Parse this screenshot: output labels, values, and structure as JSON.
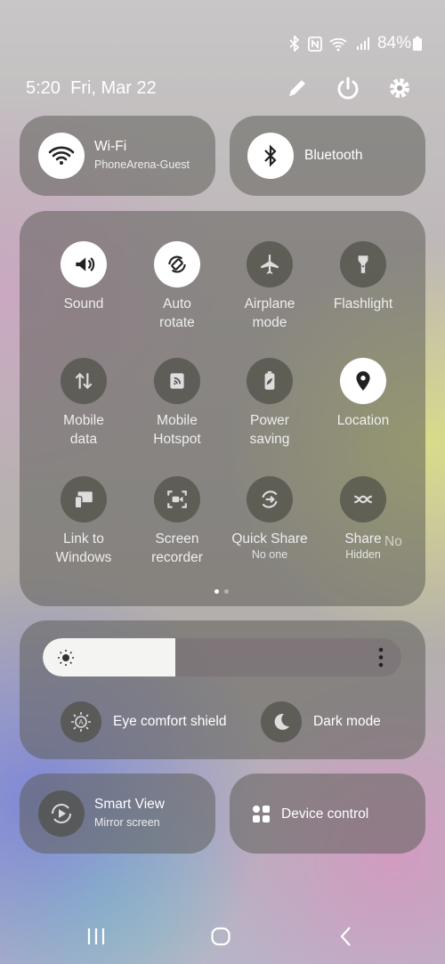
{
  "status_bar": {
    "icons": [
      "bluetooth-icon",
      "nfc-icon",
      "wifi-icon",
      "signal-icon"
    ],
    "battery": "84%",
    "battery_level": 0.84
  },
  "header": {
    "time": "5:20",
    "date": "Fri, Mar 22",
    "actions": [
      "edit-icon",
      "power-icon",
      "settings-icon"
    ]
  },
  "wifi": {
    "title": "Wi-Fi",
    "network": "PhoneArena-Guest",
    "on": true
  },
  "bluetooth": {
    "title": "Bluetooth",
    "on": true
  },
  "tiles": [
    {
      "label": "Sound",
      "icon": "sound-icon",
      "on": true
    },
    {
      "label": "Auto\nrotate",
      "icon": "auto-rotate-icon",
      "on": true
    },
    {
      "label": "Airplane\nmode",
      "icon": "airplane-icon",
      "on": false
    },
    {
      "label": "Flashlight",
      "icon": "flashlight-icon",
      "on": false
    },
    {
      "label": "Mobile\ndata",
      "icon": "mobile-data-icon",
      "on": false
    },
    {
      "label": "Mobile\nHotspot",
      "icon": "hotspot-icon",
      "on": false
    },
    {
      "label": "Power\nsaving",
      "icon": "power-saving-icon",
      "on": false
    },
    {
      "label": "Location",
      "icon": "location-icon",
      "on": true
    },
    {
      "label": "Link to\nWindows",
      "icon": "link-to-windows-icon",
      "on": false
    },
    {
      "label": "Screen\nrecorder",
      "icon": "screen-recorder-icon",
      "on": false
    },
    {
      "label": "Quick Share",
      "sub": "No one",
      "icon": "quick-share-icon",
      "on": false
    },
    {
      "label": "Share",
      "sub": "Hidden",
      "icon": "share-hidden-icon",
      "on": false
    }
  ],
  "partial_tile_label": "No",
  "pager": {
    "pages": 2,
    "current": 1
  },
  "brightness": {
    "level": 0.37
  },
  "eye_comfort": {
    "label": "Eye comfort shield"
  },
  "dark_mode": {
    "label": "Dark mode"
  },
  "smart_view": {
    "title": "Smart View",
    "sub": "Mirror screen"
  },
  "device_control": {
    "title": "Device control"
  },
  "nav": [
    "recent-apps",
    "home",
    "back"
  ]
}
